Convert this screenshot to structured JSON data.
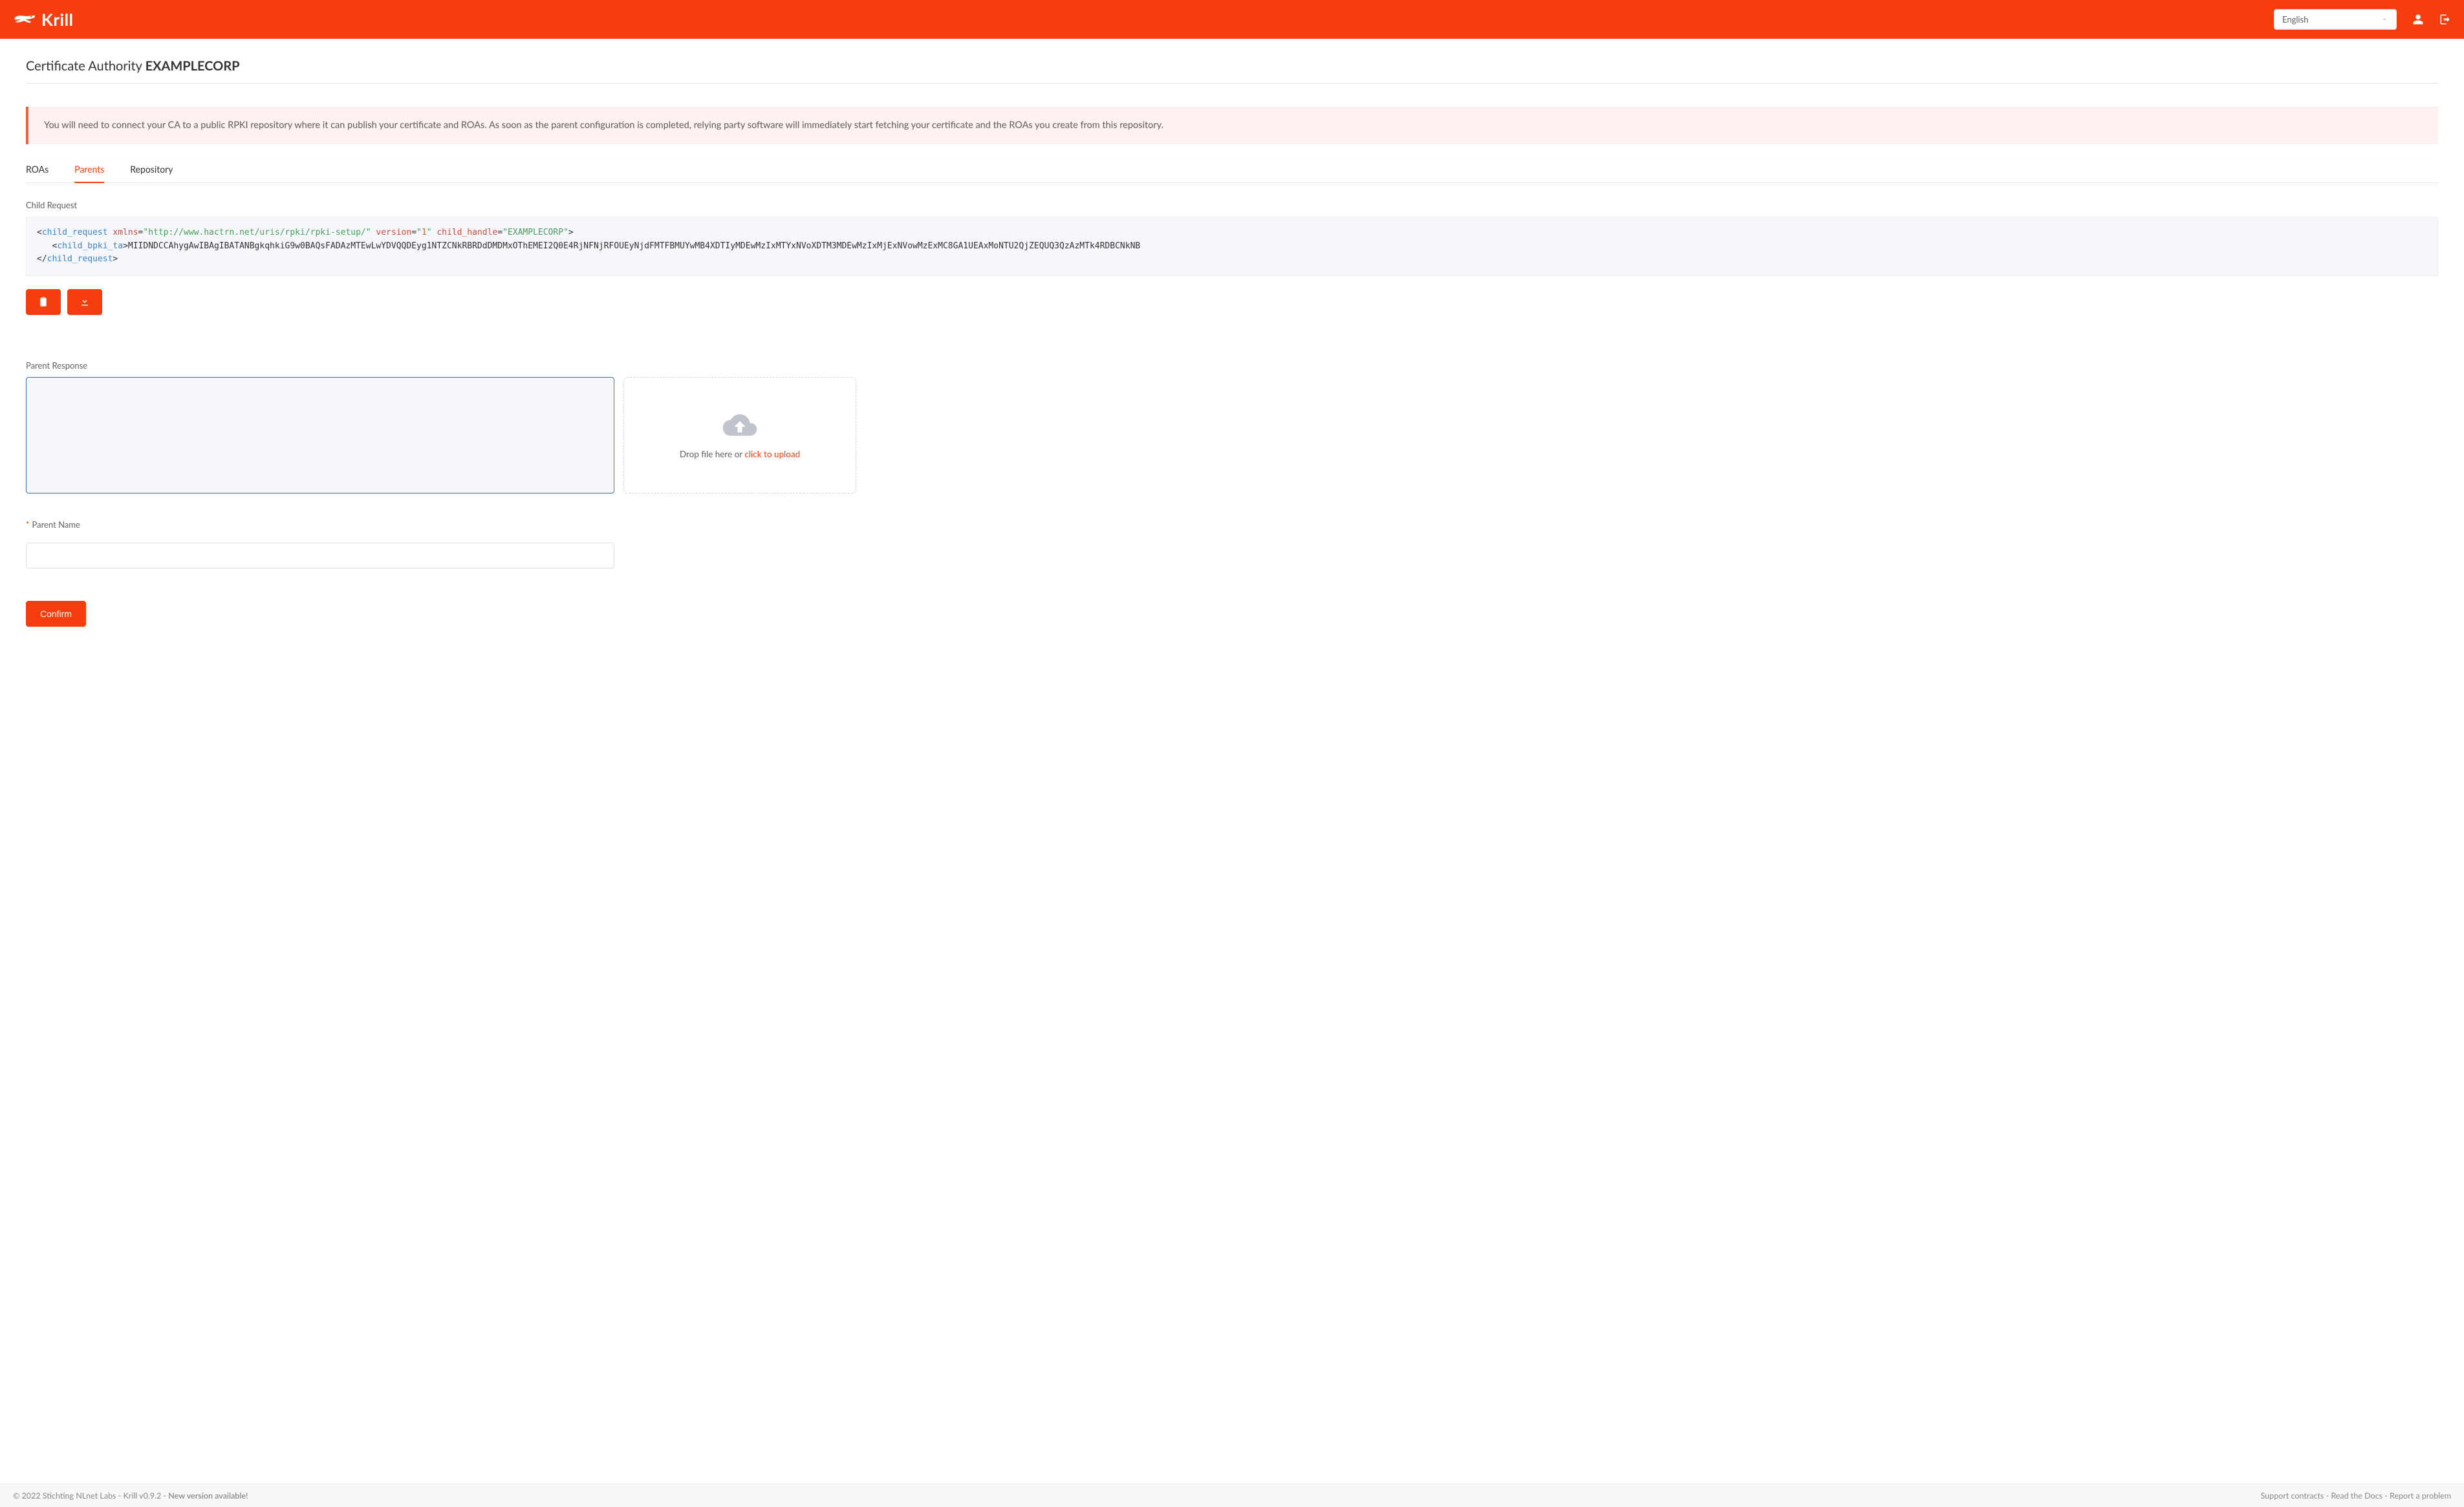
{
  "header": {
    "brand": "Krill",
    "language_selected": "English"
  },
  "page": {
    "ca_label": "Certificate Authority",
    "ca_name": "EXAMPLECORP"
  },
  "alert": {
    "text": "You will need to connect your CA to a public RPKI repository where it can publish your certificate and ROAs. As soon as the parent configuration is completed, relying party software will immediately start fetching your certificate and the ROAs you create from this repository."
  },
  "tabs": {
    "roas": "ROAs",
    "parents": "Parents",
    "repository": "Repository"
  },
  "child_request": {
    "label": "Child Request",
    "xml_tag_open": "child_request",
    "xml_tag_inner": "child_bpki_ta",
    "xmlns_attr": "xmlns",
    "xmlns_val": "http://www.hactrn.net/uris/rpki/rpki-setup/",
    "version_attr": "version",
    "version_val": "1",
    "handle_attr": "child_handle",
    "handle_val": "EXAMPLECORP",
    "ta_b64": "MIIDNDCCAhygAwIBAgIBATANBgkqhkiG9w0BAQsFADAzMTEwLwYDVQQDEyg1NTZCNkRBRDdDMDMxOThEMEI2Q0E4RjNFNjRFOUEyNjdFMTFBMUYwMB4XDTIyMDEwMzIxMTYxNVoXDTM3MDEwMzIxMjExNVowMzExMC8GA1UEAxMoNTU2QjZEQUQ3QzAzMTk4RDBCNkNB"
  },
  "parent_response": {
    "label": "Parent Response",
    "dropzone_prefix": "Drop file here or ",
    "dropzone_link": "click to upload"
  },
  "parent_name": {
    "required_mark": "*",
    "label": "Parent Name"
  },
  "actions": {
    "confirm": "Confirm"
  },
  "footer": {
    "left_prefix": "© 2022 Stichting NLnet Labs - Krill v0.9.2 - ",
    "left_bold": "New version available!",
    "support": "Support contracts",
    "docs": "Read the Docs",
    "report": "Report a problem",
    "sep": " - "
  }
}
